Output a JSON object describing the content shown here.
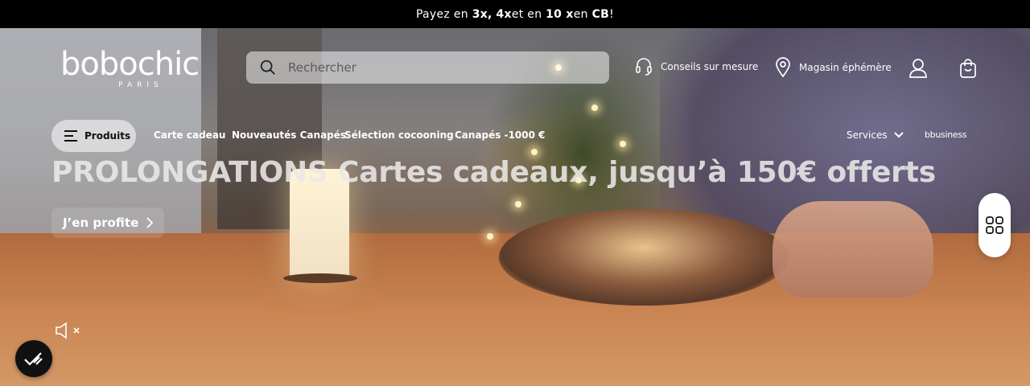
{
  "promo": {
    "prefix": "Payez en ",
    "opt1": "3x,",
    "opt2": "4x",
    "mid": " et en ",
    "opt3": "10 x",
    "mid2": " en ",
    "opt4": "CB",
    "suffix": " !"
  },
  "brand": {
    "logo_text": "bobochic",
    "logo_sub": "PARIS"
  },
  "search": {
    "placeholder": "Rechercher"
  },
  "header_links": {
    "advice": "Conseils sur mesure",
    "store": "Magasin éphémère"
  },
  "nav": {
    "products": "Produits",
    "gift_card": "Carte cadeau",
    "new_sofas": "Nouveautés Canapés",
    "cocooning": "Sélection cocooning",
    "sofas_under": "Canapés -1000 €",
    "services": "Services",
    "business": "bbusiness"
  },
  "hero": {
    "headline": "PROLONGATIONS Cartes cadeaux, jusqu’à 150€ offerts",
    "cta": "J’en profite"
  },
  "icons": {
    "search": "search-icon",
    "headset": "headset-icon",
    "location": "location-pin-icon",
    "account": "user-icon",
    "cart": "shopping-bag-icon",
    "menu": "hamburger-icon",
    "chevron": "chevron-down-icon",
    "arrow": "chevron-right-icon",
    "grid": "grid-icon",
    "mute": "speaker-muted-icon",
    "cookie": "cookie-consent-icon"
  },
  "colors": {
    "promo_bg": "#000000",
    "text_light": "#ffffff",
    "widget_bg": "#ffffff"
  }
}
